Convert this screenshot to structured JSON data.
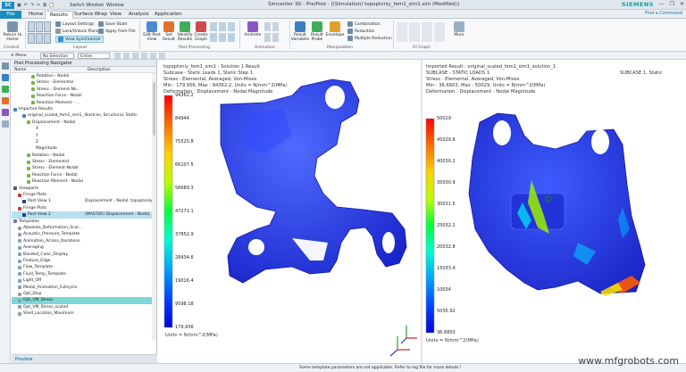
{
  "window": {
    "title": "Simcenter 3D - Pre/Post - [(Simulation) topoptonly_fem1_sim1.sim (Modified)]",
    "quick_access": [
      "Switch Window",
      "Window"
    ],
    "brand": "SIEMENS",
    "controls": [
      "—",
      "❐",
      "✕"
    ]
  },
  "tabs": [
    "File",
    "Home",
    "Results",
    "Surface Wrap",
    "View",
    "Analysis",
    "Application"
  ],
  "active_tab": "Results",
  "tab_right": "Find a Command",
  "ribbon": {
    "context": {
      "label": "Return to Home"
    },
    "layout_small": [
      "Layout Settings",
      "Lock/Unlock Plane",
      "View Synchronize"
    ],
    "state_small": [
      "Save State",
      "Apply from File"
    ],
    "postprocessing": [
      "Edit Post View",
      "Set Result",
      "Identify Results",
      "Create Graph"
    ],
    "animation": [
      "Animate"
    ],
    "manipulation": [
      "Result Variables",
      "Result Probe",
      "Envelope"
    ],
    "manip_small": [
      "Combination",
      "Reduction",
      "Multiple Reduction"
    ],
    "more": "More",
    "groups": [
      "Context",
      "Layout",
      "Post Processing",
      "Animation",
      "Manipulation",
      "Fil Graph"
    ]
  },
  "toolbar2": {
    "menu": "Menu",
    "filter": "No Selection Filter",
    "assembly": "Entire Assembly"
  },
  "navigator": {
    "title": "Post Processing Navigator",
    "col_name": "Name",
    "col_desc": "Description",
    "rows": [
      {
        "name": "Rotation - Nodal",
        "desc": "",
        "indent": 4,
        "color": "#7fb24a"
      },
      {
        "name": "Stress - Elemental",
        "desc": "",
        "indent": 4,
        "color": "#7fb24a"
      },
      {
        "name": "Stress - Element-No...",
        "desc": "",
        "indent": 4,
        "color": "#7fb24a"
      },
      {
        "name": "Reaction Force - Nodal",
        "desc": "",
        "indent": 4,
        "color": "#7fb24a"
      },
      {
        "name": "Reaction Moment - ...",
        "desc": "",
        "indent": 4,
        "color": "#7fb24a"
      },
      {
        "name": "Imported Results",
        "desc": "",
        "indent": 0,
        "color": "#3a7fc1"
      },
      {
        "name": "original_scaled_fem1_sim1_...",
        "desc": "Nastran, Structural, Static",
        "indent": 2,
        "color": "#3a7fc1"
      },
      {
        "name": "Displacement - Nodal",
        "desc": "",
        "indent": 3,
        "color": "#7fb24a"
      },
      {
        "name": "X",
        "desc": "",
        "indent": 5,
        "color": "none"
      },
      {
        "name": "Y",
        "desc": "",
        "indent": 5,
        "color": "none"
      },
      {
        "name": "Z",
        "desc": "",
        "indent": 5,
        "color": "none"
      },
      {
        "name": "Magnitude",
        "desc": "",
        "indent": 5,
        "color": "none"
      },
      {
        "name": "Rotation - Nodal",
        "desc": "",
        "indent": 3,
        "color": "#7fb24a"
      },
      {
        "name": "Stress - Elemental",
        "desc": "",
        "indent": 3,
        "color": "#7fb24a"
      },
      {
        "name": "Stress - Element-Nodal",
        "desc": "",
        "indent": 3,
        "color": "#7fb24a"
      },
      {
        "name": "Reaction Force - Nodal",
        "desc": "",
        "indent": 3,
        "color": "#7fb24a"
      },
      {
        "name": "Reaction Moment - Nodal",
        "desc": "",
        "indent": 3,
        "color": "#7fb24a"
      },
      {
        "name": "Viewports",
        "desc": "",
        "indent": 0,
        "color": "#555555"
      },
      {
        "name": "Fringe Plots",
        "desc": "",
        "indent": 1,
        "color": "#c43c3c"
      },
      {
        "name": "Post View 1",
        "desc": "Displacement - Nodal, topoptonly...",
        "indent": 2,
        "color": "#1f3f8a"
      },
      {
        "name": "Fringe Plots",
        "desc": "",
        "indent": 1,
        "color": "#c43c3c"
      },
      {
        "name": "Post View 2",
        "desc": "(MASTER) Displacement - Nodal, S...",
        "indent": 2,
        "color": "#1f3f8a",
        "selected": true
      },
      {
        "name": "Templates",
        "desc": "",
        "indent": 0,
        "color": "#6a7f93"
      },
      {
        "name": "Absolute_Deformation_Scal...",
        "desc": "",
        "indent": 1,
        "color": "#8aa0b5"
      },
      {
        "name": "Acoustic_Pressure_Template",
        "desc": "",
        "indent": 1,
        "color": "#8aa0b5"
      },
      {
        "name": "Animation_Across_Iterations",
        "desc": "",
        "indent": 1,
        "color": "#8aa0b5"
      },
      {
        "name": "Averaging",
        "desc": "",
        "indent": 1,
        "color": "#8aa0b5"
      },
      {
        "name": "Banded_Color_Display",
        "desc": "",
        "indent": 1,
        "color": "#8aa0b5"
      },
      {
        "name": "Feature_Edge",
        "desc": "",
        "indent": 1,
        "color": "#8aa0b5"
      },
      {
        "name": "Flow_Template",
        "desc": "",
        "indent": 1,
        "color": "#8aa0b5"
      },
      {
        "name": "Fluid_Temp_Template",
        "desc": "",
        "indent": 1,
        "color": "#8aa0b5"
      },
      {
        "name": "Light_Off",
        "desc": "",
        "indent": 1,
        "color": "#8aa0b5"
      },
      {
        "name": "Modal_Animation_Fullcycle",
        "desc": "",
        "indent": 1,
        "color": "#8aa0b5"
      },
      {
        "name": "Opt_Disp",
        "desc": "",
        "indent": 1,
        "color": "#8aa0b5"
      },
      {
        "name": "Opt_VM_Stress",
        "desc": "",
        "indent": 1,
        "color": "#8aa0b5",
        "selected2": true
      },
      {
        "name": "Opt_VM_Stress_scaled",
        "desc": "",
        "indent": 1,
        "color": "#8aa0b5"
      },
      {
        "name": "Shell_Location_Maximum",
        "desc": "",
        "indent": 1,
        "color": "#8aa0b5"
      }
    ],
    "preview": "Preview"
  },
  "view_left": {
    "lines": [
      "topoptonly_fem1_sim1 : Solution 1 Result",
      "Subcase - Static Loads 1, Static Step 1",
      "Stress - Elemental, Averaged, Von-Mises",
      "Min : 179.956, Max : 94362.2, Units = N/mm^2(MPa)",
      "Deformation : Displacement - Nodal Magnitude"
    ],
    "legend_values": [
      "94362.2",
      "84944",
      "75525.8",
      "66107.5",
      "56689.3",
      "47271.1",
      "37852.9",
      "28434.6",
      "19016.4",
      "9598.18",
      "179.956"
    ],
    "units": "Units = N/mm^2(MPa)"
  },
  "view_right": {
    "lines": [
      "Imported Result : original_scaled_fem1_sim1_solution_1",
      "SUBCASE - STATIC LOADS 1",
      "Stress - Elemental, Averaged, Von-Mises",
      "Min : 36.6803, Max : 50029, Units = N/mm^2(MPa)",
      "Deformation : Displacement - Nodal Magnitude"
    ],
    "subcase_right": "SUBCASE 1, Static",
    "legend_values": [
      "50029",
      "45029.6",
      "40030.2",
      "35030.9",
      "30031.5",
      "25032.1",
      "20032.8",
      "15033.4",
      "10034",
      "5035.92",
      "36.6803"
    ],
    "units": "Units = N/mm^2(MPa)"
  },
  "status": "Some template parameters are not applicable. Refer to log file for more details !",
  "watermark": "www.mfgrobots.com",
  "colors": {
    "accent": "#1c8cbf",
    "part": "#2a3fe0",
    "brand": "#0a9ea0"
  }
}
